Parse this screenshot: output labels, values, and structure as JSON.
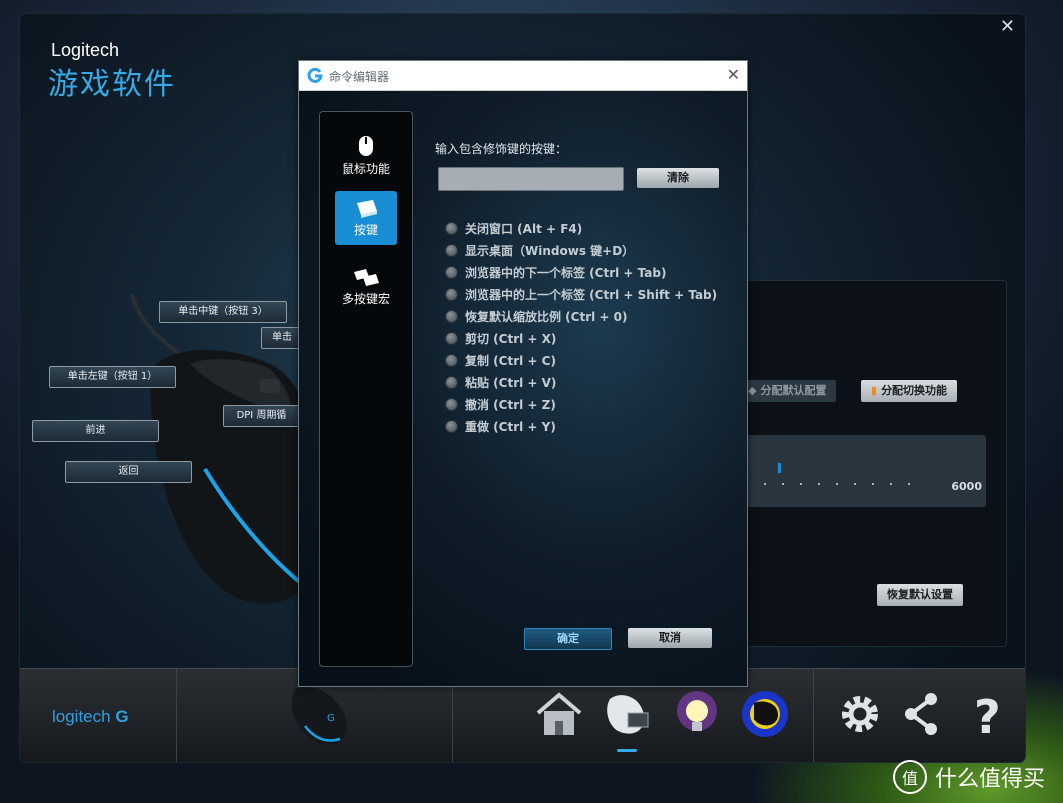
{
  "app": {
    "brand": "Logitech",
    "subtitle": "游戏软件",
    "close_icon": "close-icon"
  },
  "mouse_callouts": [
    {
      "label": "单击中键（按钮 3）"
    },
    {
      "label": "单击"
    },
    {
      "label": "单击左键（按钮 1）"
    },
    {
      "label": "DPI 周期循"
    },
    {
      "label": "前进"
    },
    {
      "label": "返回"
    }
  ],
  "right_panel": {
    "assign_default_label": "分配默认配置",
    "assign_default_mark": "◆",
    "assign_switch_label": "分配切换功能",
    "assign_switch_mark": "▮",
    "dpi_max_label": "6000",
    "restore_defaults_label": "恢复默认设置",
    "accent_color": "#1a8ed5"
  },
  "dialog": {
    "title": "命令编辑器",
    "nav": [
      {
        "label": "鼠标功能",
        "icon": "mouse-icon"
      },
      {
        "label": "按键",
        "icon": "key-icon",
        "active": true
      },
      {
        "label": "多按键宏",
        "icon": "multi-key-icon"
      }
    ],
    "prompt": "输入包含修饰键的按键：",
    "input_value": "",
    "clear_label": "清除",
    "options": [
      "关闭窗口 (Alt + F4)",
      "显示桌面（Windows 键+D）",
      "浏览器中的下一个标签 (Ctrl + Tab)",
      "浏览器中的上一个标签 (Ctrl + Shift + Tab)",
      "恢复默认缩放比例 (Ctrl + 0)",
      "剪切 (Ctrl + X)",
      "复制 (Ctrl + C)",
      "粘贴 (Ctrl + V)",
      "撤消 (Ctrl + Z)",
      "重做 (Ctrl + Y)"
    ],
    "ok_label": "确定",
    "cancel_label": "取消"
  },
  "bottom_bar": {
    "logo_text": "logitech",
    "icons": [
      "home-icon",
      "device-settings-icon",
      "lighting-icon",
      "heatmap-icon",
      "gear-icon",
      "share-icon",
      "help-icon"
    ]
  },
  "watermark": {
    "text": "什么值得买",
    "badge": "值"
  }
}
